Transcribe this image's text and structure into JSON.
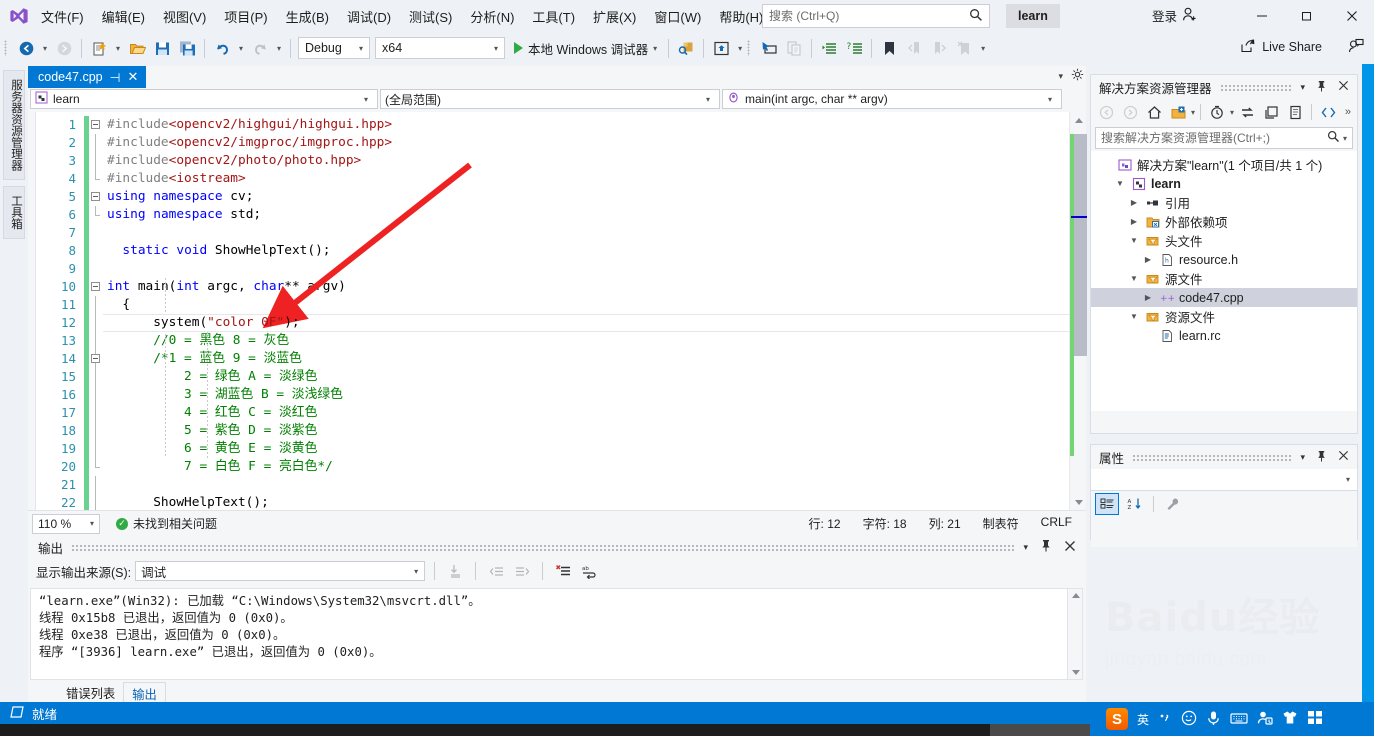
{
  "app": {
    "window_title": "learn",
    "status_text": "就绪",
    "logo_name": "visual-studio-logo"
  },
  "menubar": {
    "items": [
      "文件(F)",
      "编辑(E)",
      "视图(V)",
      "项目(P)",
      "生成(B)",
      "调试(D)",
      "测试(S)",
      "分析(N)",
      "工具(T)",
      "扩展(X)",
      "窗口(W)",
      "帮助(H)"
    ]
  },
  "titlebar": {
    "search_placeholder": "搜索 (Ctrl+Q)",
    "search_value": "",
    "solution_button": "learn",
    "signin_label": "登录",
    "minimize": "–",
    "maximize": "❐",
    "close": "✕"
  },
  "toolbar": {
    "config": "Debug",
    "platform": "x64",
    "run_label": "本地 Windows 调试器",
    "live_share": "Live Share"
  },
  "left_rail": {
    "tabs": [
      "服务器资源管理器",
      "工具箱"
    ]
  },
  "editor": {
    "tab_label": "code47.cpp",
    "project_combo": "learn",
    "scope_combo": "(全局范围)",
    "member_combo": "main(int argc, char ** argv)",
    "zoom": "110 %",
    "issues": "未找到相关问题",
    "line_label": "行: 12",
    "char_label": "字符: 18",
    "col_label": "列: 21",
    "tabs_label": "制表符",
    "eol_label": "CRLF",
    "code_lines": [
      {
        "n": 1,
        "text": "#include<opencv2/highgui/highgui.hpp>"
      },
      {
        "n": 2,
        "text": "#include<opencv2/imgproc/imgproc.hpp>"
      },
      {
        "n": 3,
        "text": "#include<opencv2/photo/photo.hpp>"
      },
      {
        "n": 4,
        "text": "#include<iostream>"
      },
      {
        "n": 5,
        "text": "using namespace cv;"
      },
      {
        "n": 6,
        "text": "using namespace std;"
      },
      {
        "n": 7,
        "text": ""
      },
      {
        "n": 8,
        "text": "static void ShowHelpText();"
      },
      {
        "n": 9,
        "text": ""
      },
      {
        "n": 10,
        "text": "int main(int argc, char** argv)"
      },
      {
        "n": 11,
        "text": "{"
      },
      {
        "n": 12,
        "text": "system(\"color 0F\");"
      },
      {
        "n": 13,
        "text": "//0 = 黑色 8 = 灰色"
      },
      {
        "n": 14,
        "text": "/*1 = 蓝色 9 = 淡蓝色"
      },
      {
        "n": 15,
        "text": "2 = 绿色 A = 淡绿色"
      },
      {
        "n": 16,
        "text": "3 = 湖蓝色 B = 淡浅绿色"
      },
      {
        "n": 17,
        "text": "4 = 红色 C = 淡红色"
      },
      {
        "n": 18,
        "text": "5 = 紫色 D = 淡紫色"
      },
      {
        "n": 19,
        "text": "6 = 黄色 E = 淡黄色"
      },
      {
        "n": 20,
        "text": "7 = 白色 F = 亮白色*/"
      },
      {
        "n": 21,
        "text": ""
      },
      {
        "n": 22,
        "text": "ShowHelpText();"
      }
    ]
  },
  "output": {
    "title": "输出",
    "source_label": "显示输出来源(S):",
    "source_value": "调试",
    "lines": [
      "“learn.exe”(Win32): 已加载 “C:\\Windows\\System32\\msvcrt.dll”。",
      "线程 0x15b8 已退出，返回值为 0 (0x0)。",
      "线程 0xe38 已退出，返回值为 0 (0x0)。",
      "程序 “[3936] learn.exe” 已退出，返回值为 0 (0x0)。"
    ],
    "bottom_tabs": [
      {
        "label": "错误列表",
        "active": false
      },
      {
        "label": "输出",
        "active": true
      }
    ]
  },
  "solution_explorer": {
    "title": "解决方案资源管理器",
    "search_placeholder": "搜索解决方案资源管理器(Ctrl+;)",
    "search_value": "",
    "tree": [
      {
        "label": "解决方案\"learn\"(1 个项目/共 1 个)",
        "indent": 0,
        "twisty": "",
        "icon": "solution-icon",
        "bold": false,
        "selected": false
      },
      {
        "label": "learn",
        "indent": 1,
        "twisty": "▼",
        "icon": "project-icon",
        "bold": true,
        "selected": false
      },
      {
        "label": "引用",
        "indent": 2,
        "twisty": "▶",
        "icon": "references-icon",
        "bold": false,
        "selected": false
      },
      {
        "label": "外部依赖项",
        "indent": 2,
        "twisty": "▶",
        "icon": "folder-ext-icon",
        "bold": false,
        "selected": false
      },
      {
        "label": "头文件",
        "indent": 2,
        "twisty": "▼",
        "icon": "filter-folder-icon",
        "bold": false,
        "selected": false
      },
      {
        "label": "resource.h",
        "indent": 3,
        "twisty": "▶",
        "icon": "header-file-icon",
        "bold": false,
        "selected": false
      },
      {
        "label": "源文件",
        "indent": 2,
        "twisty": "▼",
        "icon": "filter-folder-icon",
        "bold": false,
        "selected": false
      },
      {
        "label": "code47.cpp",
        "indent": 3,
        "twisty": "▶",
        "icon": "cpp-file-icon",
        "bold": false,
        "selected": true
      },
      {
        "label": "资源文件",
        "indent": 2,
        "twisty": "▼",
        "icon": "filter-folder-icon",
        "bold": false,
        "selected": false
      },
      {
        "label": "learn.rc",
        "indent": 3,
        "twisty": "",
        "icon": "rc-file-icon",
        "bold": false,
        "selected": false
      }
    ]
  },
  "properties": {
    "title": "属性",
    "selected": ""
  },
  "watermark": {
    "line1": "Baidu经验",
    "line2": "jingyan.baidu.com"
  },
  "tray": {
    "ime": "英",
    "items": [
      "sogou-icon",
      "ime-cn-icon",
      "comma-icon",
      "emoji-icon",
      "mic-icon",
      "keyboard-icon",
      "user-icon",
      "shirt-icon",
      "apps-icon"
    ]
  },
  "colors": {
    "accent": "#0078d4",
    "chrome": "#eef1f6",
    "comment": "#008000",
    "keyword": "#0000ff",
    "string": "#a31515",
    "type": "#2b91af",
    "arrow_red": "#ee2222"
  }
}
